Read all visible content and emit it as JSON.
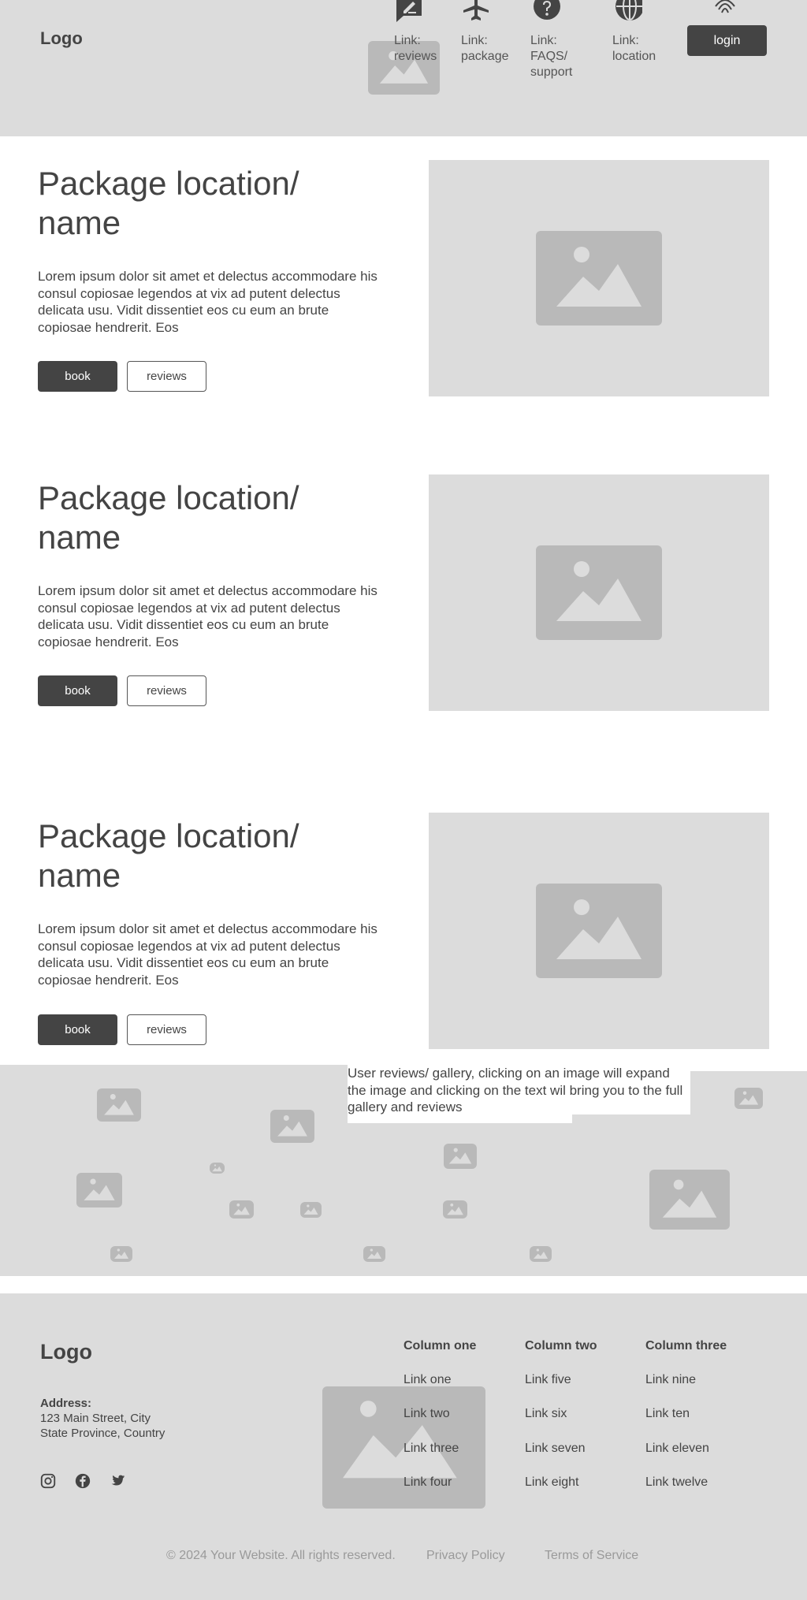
{
  "header": {
    "logo": "Logo",
    "nav": [
      {
        "label": "Link: reviews",
        "icon": "rate-review-icon"
      },
      {
        "label": "Link: package",
        "icon": "airplane-icon"
      },
      {
        "label": "Link: FAQS/ support",
        "icon": "help-icon"
      },
      {
        "label": "Link: location",
        "icon": "globe-icon"
      },
      {
        "label": "",
        "icon": "fingerprint-icon"
      }
    ],
    "login_label": "login"
  },
  "packages": [
    {
      "title": "Package location/ name",
      "description": "Lorem ipsum dolor sit amet et delectus accommodare his consul copiosae legendos at vix ad putent delectus delicata usu. Vidit dissentiet eos cu eum an brute copiosae hendrerit. Eos",
      "book_label": "book",
      "reviews_label": "reviews"
    },
    {
      "title": "Package location/ name",
      "description": "Lorem ipsum dolor sit amet et delectus accommodare his consul copiosae legendos at vix ad putent delectus delicata usu. Vidit dissentiet eos cu eum an brute copiosae hendrerit. Eos",
      "book_label": "book",
      "reviews_label": "reviews"
    },
    {
      "title": "Package location/ name",
      "description": "Lorem ipsum dolor sit amet et delectus accommodare his consul copiosae legendos at vix ad putent delectus delicata usu. Vidit dissentiet eos cu eum an brute copiosae hendrerit. Eos",
      "book_label": "book",
      "reviews_label": "reviews"
    }
  ],
  "gallery": {
    "caption": "User reviews/ gallery, clicking on an image will expand the image and clicking on the text wil bring you to the full gallery and reviews"
  },
  "footer": {
    "logo": "Logo",
    "address_label": "Address:",
    "address_line1": "123 Main Street, City",
    "address_line2": "State Province, Country",
    "social": [
      "instagram-icon",
      "facebook-icon",
      "twitter-icon"
    ],
    "columns": [
      {
        "title": "Column one",
        "links": [
          "Link one",
          "Link two",
          "Link three",
          "Link four"
        ]
      },
      {
        "title": "Column two",
        "links": [
          "Link five",
          "Link six",
          "Link seven",
          "Link eight"
        ]
      },
      {
        "title": "Column three",
        "links": [
          "Link nine",
          "Link ten",
          "Link eleven",
          "Link twelve"
        ]
      }
    ],
    "copyright": "© 2024 Your Website. All rights reserved.",
    "privacy_label": "Privacy Policy",
    "terms_label": "Terms of Service"
  },
  "colors": {
    "placeholder_bg": "#dcdcdc",
    "placeholder_icon": "#b9b9b9",
    "dark_button": "#444444",
    "text": "#444444",
    "muted_text": "#9a9a9a"
  }
}
